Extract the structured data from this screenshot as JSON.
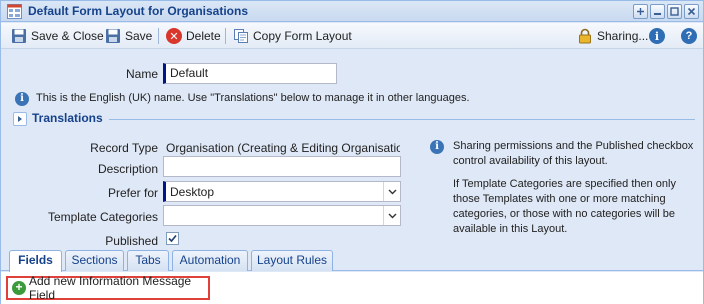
{
  "window": {
    "title": "Default Form Layout for Organisations"
  },
  "toolbar": {
    "save_close": "Save & Close",
    "save": "Save",
    "delete": "Delete",
    "copy": "Copy Form Layout",
    "sharing": "Sharing..."
  },
  "form": {
    "name_label": "Name",
    "name_value": "Default",
    "name_note": "This is the English (UK) name. Use \"Translations\" below to manage it in other languages.",
    "translations_header": "Translations",
    "record_type_label": "Record Type",
    "record_type_value": "Organisation (Creating & Editing Organisations)",
    "description_label": "Description",
    "description_value": "",
    "prefer_for_label": "Prefer for",
    "prefer_for_value": "Desktop",
    "template_categories_label": "Template Categories",
    "template_categories_value": "",
    "published_label": "Published",
    "published_checked": true
  },
  "info_panel": {
    "line1": "Sharing permissions and the Published checkbox",
    "line2": "control availability of this layout.",
    "line3": "If Template Categories are specified then only",
    "line4": "those Templates with one or more matching",
    "line5": "categories, or those with no categories will be",
    "line6": "available in this Layout."
  },
  "tabs": [
    {
      "label": "Fields",
      "active": true
    },
    {
      "label": "Sections",
      "active": false
    },
    {
      "label": "Tabs",
      "active": false
    },
    {
      "label": "Automation",
      "active": false
    },
    {
      "label": "Layout Rules",
      "active": false
    }
  ],
  "fields_tab": {
    "add_button": "Add new Information Message Field"
  },
  "colors": {
    "accent": "#15428b",
    "required": "#00148c",
    "highlight": "#e0403a"
  }
}
